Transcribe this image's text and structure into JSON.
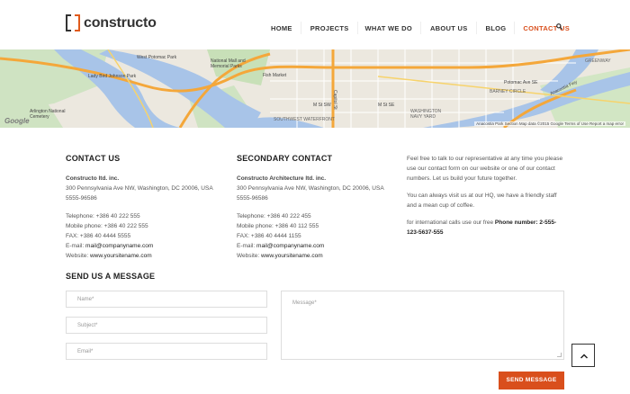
{
  "brand": {
    "name": "constructo"
  },
  "nav": {
    "items": [
      {
        "label": "HOME",
        "active": false
      },
      {
        "label": "PROJECTS",
        "active": false
      },
      {
        "label": "WHAT WE DO",
        "active": false
      },
      {
        "label": "ABOUT US",
        "active": false
      },
      {
        "label": "BLOG",
        "active": false
      },
      {
        "label": "CONTACT US",
        "active": true
      }
    ],
    "search_icon": "search-icon",
    "accent_color": "#d94f1c"
  },
  "map": {
    "labels": [
      "West Potomac Park",
      "National Mall and Memorial Parks",
      "Lady Bird Johnson Park",
      "Arlington National Cemetery",
      "Fish Market",
      "SOUTHWEST WATERFRONT",
      "BARNEY CIRCLE",
      "WASHINGTON NAVY YARD",
      "Anacostia Park",
      "GREENWAY",
      "Potomac Ave SE",
      "Anacostia Fwy",
      "M St SE",
      "M St SW",
      "Capitol St"
    ],
    "footer": {
      "park": "Anacostia Park",
      "section": "Section",
      "data": "Map data ©2015 Google",
      "terms": "Terms of Use",
      "report": "Report a map error"
    },
    "google": "Google"
  },
  "contact": {
    "title": "CONTACT US",
    "company": "Constructo ltd. inc.",
    "address": "300 Pennsylvania Ave NW, Washington, DC 20006, USA",
    "zip": "5555-96586",
    "telephone": "Telephone: +386 40 222 555",
    "mobile": "Mobile phone: +386 40 222 555",
    "fax": "FAX: +386 40 4444 5555",
    "email_label": "E-mail:",
    "email": "mail@companyname.com",
    "website_label": "Website:",
    "website": "www.yoursitename.com"
  },
  "secondary": {
    "title": "SECONDARY CONTACT",
    "company": "Constructo Architecture ltd. inc.",
    "address": "300 Pennsylvania Ave NW, Washington, DC 20006, USA",
    "zip": "5555-96586",
    "telephone": "Telephone: +386 40 222 455",
    "mobile": "Mobile phone: +386 40 112 555",
    "fax": "FAX: +386 40 4444 1155",
    "email_label": "E-mail:",
    "email": "mail@companyname.com",
    "website_label": "Website:",
    "website": "www.yoursitename.com"
  },
  "info": {
    "p1": "Feel free to talk to our representative at any time you please use our contact form on our website or one of our contact numbers. Let us build your future together.",
    "p2": "You can always visit us at our HQ, we have a friendly staff and a mean cup of coffee.",
    "p3_prefix": "for international calls use our free",
    "p3_bold": "Phone number: 2-555-123-5637-555"
  },
  "form": {
    "title": "SEND US A MESSAGE",
    "name_placeholder": "Name*",
    "subject_placeholder": "Subject*",
    "email_placeholder": "Email*",
    "message_placeholder": "Message*",
    "submit_label": "SEND MESSAGE",
    "back_to_top_icon": "chevron-up-icon"
  }
}
